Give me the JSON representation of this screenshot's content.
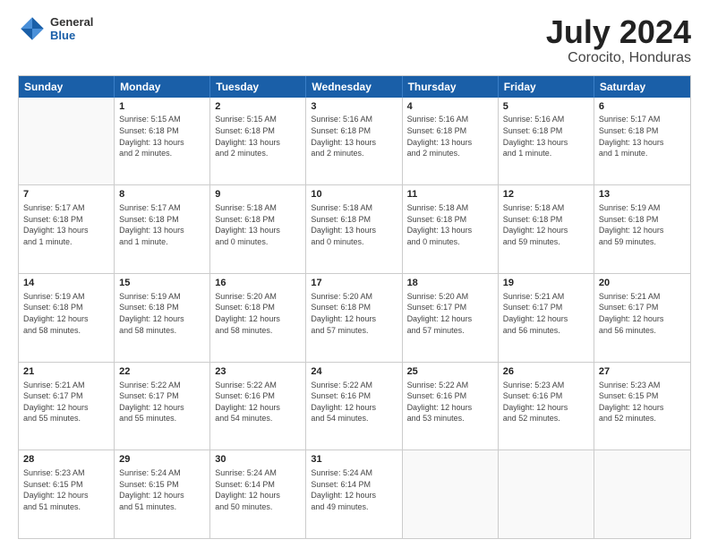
{
  "header": {
    "logo_general": "General",
    "logo_blue": "Blue",
    "month_year": "July 2024",
    "location": "Corocito, Honduras"
  },
  "days_of_week": [
    "Sunday",
    "Monday",
    "Tuesday",
    "Wednesday",
    "Thursday",
    "Friday",
    "Saturday"
  ],
  "weeks": [
    [
      {
        "day": "",
        "info": ""
      },
      {
        "day": "1",
        "info": "Sunrise: 5:15 AM\nSunset: 6:18 PM\nDaylight: 13 hours\nand 2 minutes."
      },
      {
        "day": "2",
        "info": "Sunrise: 5:15 AM\nSunset: 6:18 PM\nDaylight: 13 hours\nand 2 minutes."
      },
      {
        "day": "3",
        "info": "Sunrise: 5:16 AM\nSunset: 6:18 PM\nDaylight: 13 hours\nand 2 minutes."
      },
      {
        "day": "4",
        "info": "Sunrise: 5:16 AM\nSunset: 6:18 PM\nDaylight: 13 hours\nand 2 minutes."
      },
      {
        "day": "5",
        "info": "Sunrise: 5:16 AM\nSunset: 6:18 PM\nDaylight: 13 hours\nand 1 minute."
      },
      {
        "day": "6",
        "info": "Sunrise: 5:17 AM\nSunset: 6:18 PM\nDaylight: 13 hours\nand 1 minute."
      }
    ],
    [
      {
        "day": "7",
        "info": "Sunrise: 5:17 AM\nSunset: 6:18 PM\nDaylight: 13 hours\nand 1 minute."
      },
      {
        "day": "8",
        "info": "Sunrise: 5:17 AM\nSunset: 6:18 PM\nDaylight: 13 hours\nand 1 minute."
      },
      {
        "day": "9",
        "info": "Sunrise: 5:18 AM\nSunset: 6:18 PM\nDaylight: 13 hours\nand 0 minutes."
      },
      {
        "day": "10",
        "info": "Sunrise: 5:18 AM\nSunset: 6:18 PM\nDaylight: 13 hours\nand 0 minutes."
      },
      {
        "day": "11",
        "info": "Sunrise: 5:18 AM\nSunset: 6:18 PM\nDaylight: 13 hours\nand 0 minutes."
      },
      {
        "day": "12",
        "info": "Sunrise: 5:18 AM\nSunset: 6:18 PM\nDaylight: 12 hours\nand 59 minutes."
      },
      {
        "day": "13",
        "info": "Sunrise: 5:19 AM\nSunset: 6:18 PM\nDaylight: 12 hours\nand 59 minutes."
      }
    ],
    [
      {
        "day": "14",
        "info": "Sunrise: 5:19 AM\nSunset: 6:18 PM\nDaylight: 12 hours\nand 58 minutes."
      },
      {
        "day": "15",
        "info": "Sunrise: 5:19 AM\nSunset: 6:18 PM\nDaylight: 12 hours\nand 58 minutes."
      },
      {
        "day": "16",
        "info": "Sunrise: 5:20 AM\nSunset: 6:18 PM\nDaylight: 12 hours\nand 58 minutes."
      },
      {
        "day": "17",
        "info": "Sunrise: 5:20 AM\nSunset: 6:18 PM\nDaylight: 12 hours\nand 57 minutes."
      },
      {
        "day": "18",
        "info": "Sunrise: 5:20 AM\nSunset: 6:17 PM\nDaylight: 12 hours\nand 57 minutes."
      },
      {
        "day": "19",
        "info": "Sunrise: 5:21 AM\nSunset: 6:17 PM\nDaylight: 12 hours\nand 56 minutes."
      },
      {
        "day": "20",
        "info": "Sunrise: 5:21 AM\nSunset: 6:17 PM\nDaylight: 12 hours\nand 56 minutes."
      }
    ],
    [
      {
        "day": "21",
        "info": "Sunrise: 5:21 AM\nSunset: 6:17 PM\nDaylight: 12 hours\nand 55 minutes."
      },
      {
        "day": "22",
        "info": "Sunrise: 5:22 AM\nSunset: 6:17 PM\nDaylight: 12 hours\nand 55 minutes."
      },
      {
        "day": "23",
        "info": "Sunrise: 5:22 AM\nSunset: 6:16 PM\nDaylight: 12 hours\nand 54 minutes."
      },
      {
        "day": "24",
        "info": "Sunrise: 5:22 AM\nSunset: 6:16 PM\nDaylight: 12 hours\nand 54 minutes."
      },
      {
        "day": "25",
        "info": "Sunrise: 5:22 AM\nSunset: 6:16 PM\nDaylight: 12 hours\nand 53 minutes."
      },
      {
        "day": "26",
        "info": "Sunrise: 5:23 AM\nSunset: 6:16 PM\nDaylight: 12 hours\nand 52 minutes."
      },
      {
        "day": "27",
        "info": "Sunrise: 5:23 AM\nSunset: 6:15 PM\nDaylight: 12 hours\nand 52 minutes."
      }
    ],
    [
      {
        "day": "28",
        "info": "Sunrise: 5:23 AM\nSunset: 6:15 PM\nDaylight: 12 hours\nand 51 minutes."
      },
      {
        "day": "29",
        "info": "Sunrise: 5:24 AM\nSunset: 6:15 PM\nDaylight: 12 hours\nand 51 minutes."
      },
      {
        "day": "30",
        "info": "Sunrise: 5:24 AM\nSunset: 6:14 PM\nDaylight: 12 hours\nand 50 minutes."
      },
      {
        "day": "31",
        "info": "Sunrise: 5:24 AM\nSunset: 6:14 PM\nDaylight: 12 hours\nand 49 minutes."
      },
      {
        "day": "",
        "info": ""
      },
      {
        "day": "",
        "info": ""
      },
      {
        "day": "",
        "info": ""
      }
    ]
  ]
}
